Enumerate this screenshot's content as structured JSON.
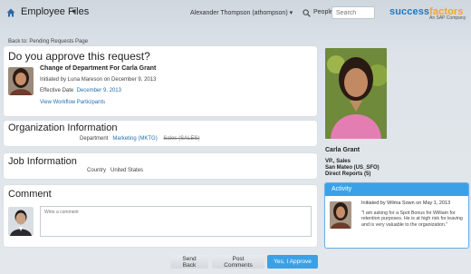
{
  "header": {
    "module_title": "Employee Files",
    "user_menu": "Alexander Thompson (athompson)",
    "search_scope": "People",
    "search_placeholder": "Search",
    "logo_part1": "success",
    "logo_part2": "factors",
    "logo_sub": "An SAP Company"
  },
  "back_link": "Back to: Pending Requests Page",
  "approval": {
    "title": "Do you approve this request?",
    "request_title": "Change of Department For Carla Grant",
    "initiated": "Initiated by Luna Mareson on December 9, 2013",
    "effective_label": "Effective Date",
    "effective_date": "December 9, 2013",
    "workflow_link": "View Workflow Participants"
  },
  "organization": {
    "title": "Organization Information",
    "field_label": "Department",
    "new_value": "Marketing (MKTG)",
    "old_value": "Sales (SALES)"
  },
  "job": {
    "title": "Job Information",
    "field_label": "Country",
    "value": "United States"
  },
  "comment": {
    "title": "Comment",
    "placeholder": "Write a comment"
  },
  "buttons": {
    "send_back": "Send Back",
    "post_comments": "Post Comments",
    "approve": "Yes, I Approve"
  },
  "profile": {
    "name": "Carla Grant",
    "title": "VP., Sales",
    "location": "San Mateo (US_SFO)",
    "reports": "Direct Reports (5)"
  },
  "activity": {
    "title": "Activity",
    "meta": "Initiated by Wilma Sown on May 1, 2013",
    "quote": "\"I am asking for a Spot Bonus for William for retention purposes. He is at high risk for leaving and is very valuable to the organization.\""
  },
  "colors": {
    "accent": "#3aa1e8",
    "link": "#1f6fb5",
    "logo_blue": "#1f77c1",
    "logo_orange": "#f5a623"
  },
  "icons": [
    "home-icon",
    "chevron-down-icon",
    "search-icon"
  ]
}
